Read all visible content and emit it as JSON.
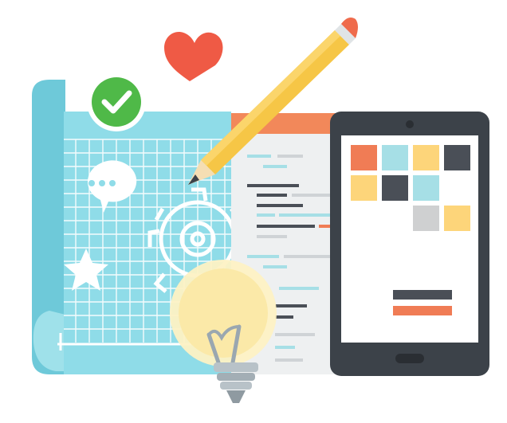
{
  "illustration": {
    "colors": {
      "blueprint": "#8fdce8",
      "blueprint_dark": "#6ec9d9",
      "grid_line": "#ffffff",
      "code_panel": "#eef0f1",
      "code_header": "#f2885a",
      "tablet_body": "#3c4249",
      "tablet_screen": "#ffffff",
      "pencil": "#f6c646",
      "heart": "#ef5a45",
      "check_badge": "#4fb948",
      "bulb": "#fbe9a8"
    },
    "icons": {
      "heart": "heart-icon",
      "check": "checkmark-badge-icon",
      "pencil": "pencil-icon",
      "chat": "chat-bubble-icon",
      "gear": "gear-icon",
      "star": "star-icon",
      "bulb": "lightbulb-icon",
      "tablet": "tablet-device-icon"
    },
    "tablet_tiles": [
      "#f07c55",
      "#a6dfe6",
      "#fdd57a",
      "#4a4f57",
      "#fdd57a",
      "#4a4f57",
      "#a6dfe6",
      "#cfd0d1",
      "#fdd57a"
    ],
    "tablet_bars": [
      "#4a4f57",
      "#f07c55"
    ]
  }
}
